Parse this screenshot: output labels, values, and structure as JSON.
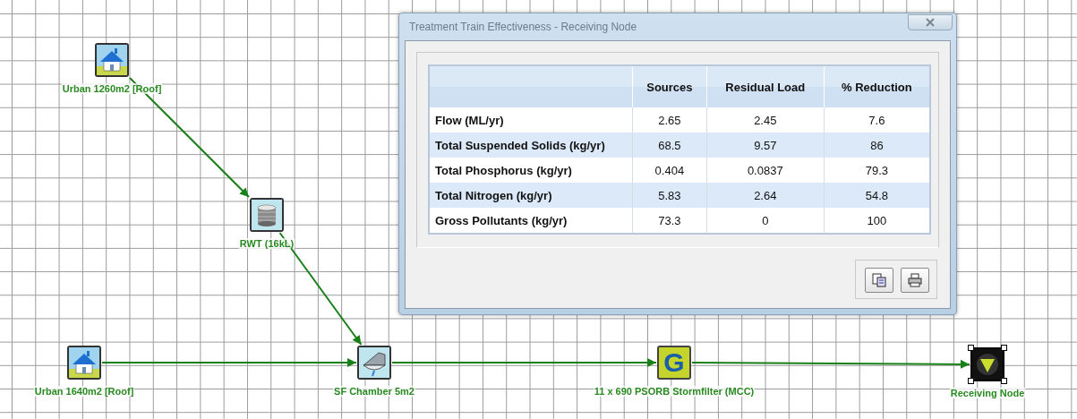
{
  "canvas": {
    "nodes": [
      {
        "kind": "house",
        "label": "Urban 1260m2 [Roof]",
        "selected": false
      },
      {
        "kind": "tank",
        "label": "RWT (16kL)",
        "selected": false
      },
      {
        "kind": "house",
        "label": "Urban 1640m2 [Roof]",
        "selected": false
      },
      {
        "kind": "chamber",
        "label": "SF Chamber 5m2",
        "selected": false
      },
      {
        "kind": "gpt",
        "label": "11 x 690 PSORB Stormfilter (MCC)",
        "icon_letter": "G",
        "selected": false
      },
      {
        "kind": "receiving",
        "label": "Receiving Node",
        "selected": true
      }
    ]
  },
  "dialog": {
    "title": "Treatment Train Effectiveness - Receiving Node",
    "table": {
      "columns": [
        "",
        "Sources",
        "Residual Load",
        "% Reduction"
      ],
      "rows": [
        [
          "Flow (ML/yr)",
          "2.65",
          "2.45",
          "7.6"
        ],
        [
          "Total Suspended Solids (kg/yr)",
          "68.5",
          "9.57",
          "86"
        ],
        [
          "Total Phosphorus (kg/yr)",
          "0.404",
          "0.0837",
          "79.3"
        ],
        [
          "Total Nitrogen (kg/yr)",
          "5.83",
          "2.64",
          "54.8"
        ],
        [
          "Gross Pollutants (kg/yr)",
          "73.3",
          "0",
          "100"
        ]
      ]
    },
    "buttons": [
      {
        "kind": "copy"
      },
      {
        "kind": "print"
      }
    ]
  }
}
